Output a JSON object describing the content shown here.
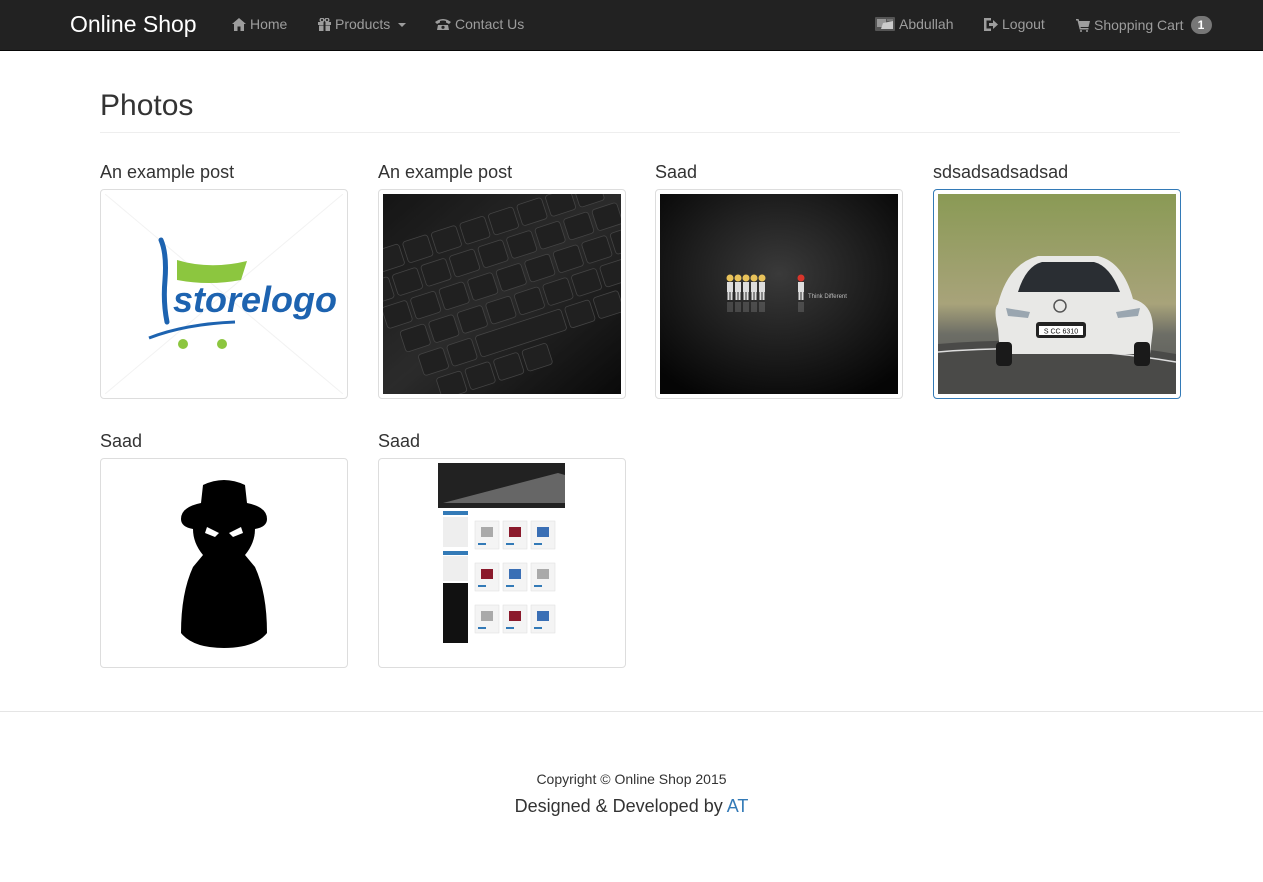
{
  "navbar": {
    "brand": "Online Shop",
    "left_items": [
      {
        "label": "Home",
        "icon": "home-icon"
      },
      {
        "label": "Products",
        "icon": "gift-icon",
        "has_caret": true
      },
      {
        "label": "Contact Us",
        "icon": "phone-icon"
      }
    ],
    "right_items": [
      {
        "label": "Abdullah",
        "icon": "user-avatar-icon"
      },
      {
        "label": "Logout",
        "icon": "logout-icon"
      },
      {
        "label": "Shopping Cart",
        "icon": "cart-icon",
        "badge": "1"
      }
    ]
  },
  "page": {
    "title": "Photos"
  },
  "gallery": [
    {
      "title": "An example post",
      "image": "store-logo-image"
    },
    {
      "title": "An example post",
      "image": "keyboard-image"
    },
    {
      "title": "Saad",
      "image": "think-different-image"
    },
    {
      "title": "sdsadsadsadsad",
      "image": "car-image",
      "active": true
    },
    {
      "title": "Saad",
      "image": "spy-silhouette-image"
    },
    {
      "title": "Saad",
      "image": "website-screenshot-image"
    }
  ],
  "images": {
    "store_logo_text": "storelogo",
    "think_different_text": "Think  Different",
    "plate_text": "S CC 6310"
  },
  "footer": {
    "copyright": "Copyright © Online Shop 2015",
    "credit_prefix": "Designed & Developed by ",
    "credit_link": "AT"
  },
  "colors": {
    "navbar_bg": "#222222",
    "nav_text": "#9d9d9d",
    "link": "#337ab7",
    "badge": "#777777"
  }
}
